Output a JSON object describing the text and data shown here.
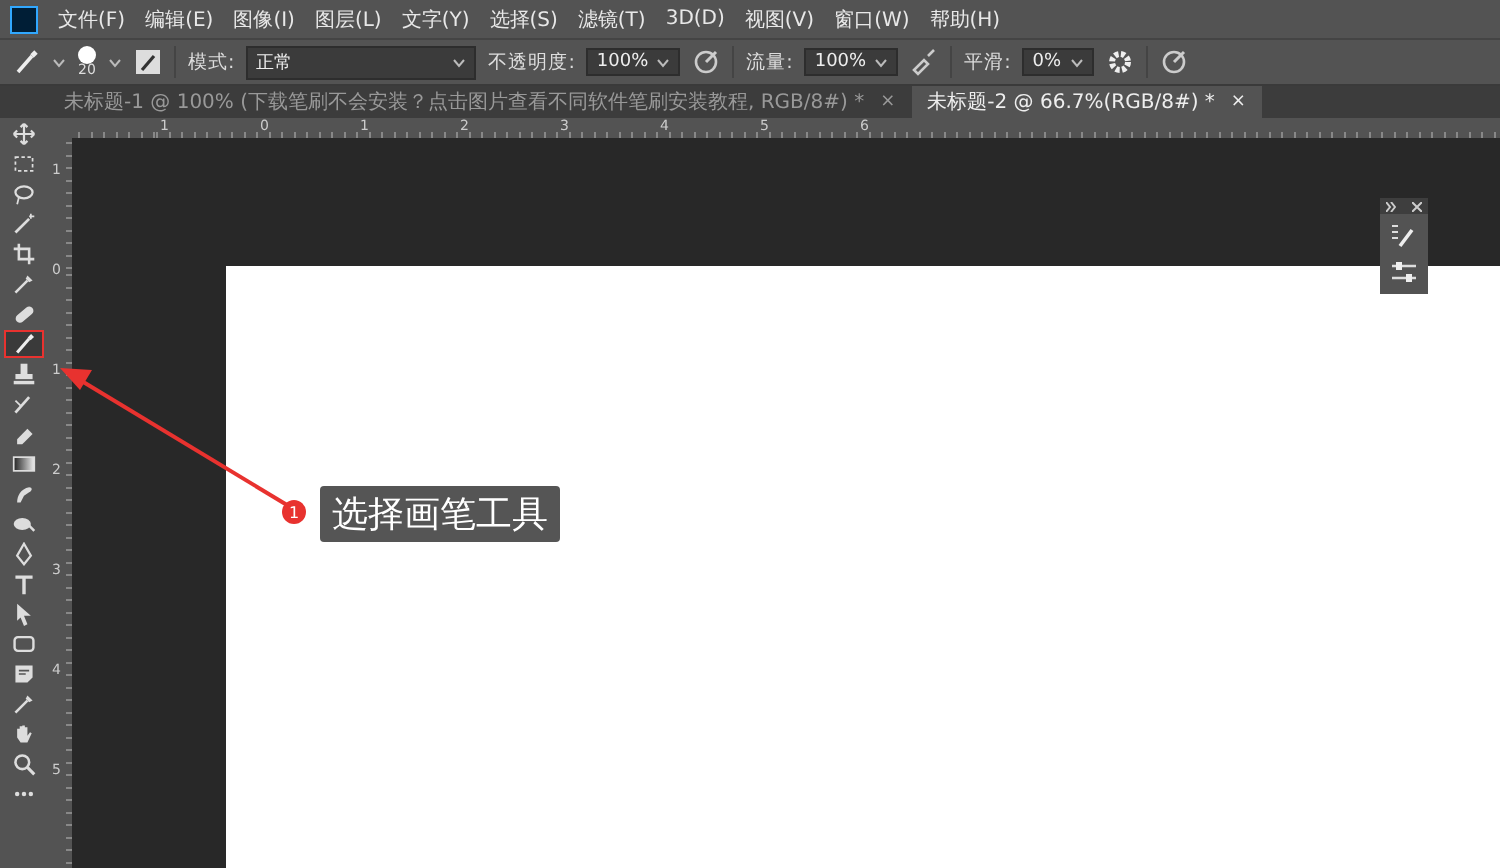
{
  "menu_bar": {
    "items": [
      "文件(F)",
      "编辑(E)",
      "图像(I)",
      "图层(L)",
      "文字(Y)",
      "选择(S)",
      "滤镜(T)",
      "3D(D)",
      "视图(V)",
      "窗口(W)",
      "帮助(H)"
    ]
  },
  "options_bar": {
    "brush_size": "20",
    "mode_label": "模式:",
    "mode_value": "正常",
    "opacity_label": "不透明度:",
    "opacity_value": "100%",
    "flow_label": "流量:",
    "flow_value": "100%",
    "smoothing_label": "平滑:",
    "smoothing_value": "0%"
  },
  "tabs": [
    {
      "label": "未标题-1 @ 100% (下载笔刷不会安装？点击图片查看不同软件笔刷安装教程, RGB/8#) *",
      "close": "×",
      "selected": false
    },
    {
      "label": "未标题-2 @ 66.7%(RGB/8#) *",
      "close": "×",
      "selected": true
    }
  ],
  "rulers": {
    "top_labels": [
      "1",
      "0",
      "1",
      "2",
      "3",
      "4",
      "5",
      "6"
    ],
    "left_labels": [
      "1",
      "0",
      "1",
      "2",
      "3",
      "4",
      "5"
    ]
  },
  "toolbar": {
    "tools": [
      {
        "kind": "move",
        "selected": false
      },
      {
        "kind": "marquee",
        "selected": false
      },
      {
        "kind": "lasso",
        "selected": false
      },
      {
        "kind": "wand",
        "selected": false
      },
      {
        "kind": "crop",
        "selected": false
      },
      {
        "kind": "eyedropper",
        "selected": false
      },
      {
        "kind": "bandage",
        "selected": false
      },
      {
        "kind": "brush",
        "selected": true
      },
      {
        "kind": "stamp",
        "selected": false
      },
      {
        "kind": "history",
        "selected": false
      },
      {
        "kind": "eraser",
        "selected": false
      },
      {
        "kind": "gradient",
        "selected": false
      },
      {
        "kind": "smudge",
        "selected": false
      },
      {
        "kind": "dodge",
        "selected": false
      },
      {
        "kind": "pen",
        "selected": false
      },
      {
        "kind": "type",
        "selected": false
      },
      {
        "kind": "select",
        "selected": false
      },
      {
        "kind": "shape",
        "selected": false
      },
      {
        "kind": "note",
        "selected": false
      },
      {
        "kind": "eyedropper",
        "selected": false
      },
      {
        "kind": "hand",
        "selected": false
      },
      {
        "kind": "zoom",
        "selected": false
      },
      {
        "kind": "more",
        "selected": false
      }
    ]
  },
  "callout": {
    "number": "1",
    "text": "选择画笔工具"
  }
}
